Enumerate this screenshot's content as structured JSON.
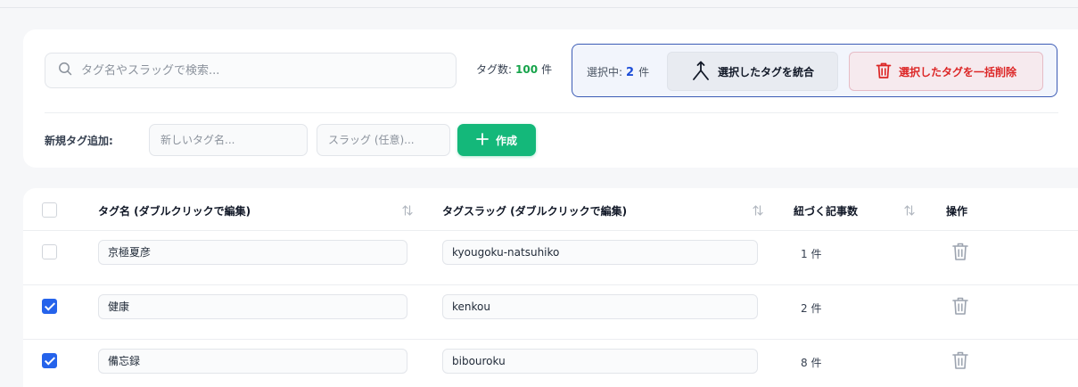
{
  "search": {
    "placeholder": "タグ名やスラッグで検索...",
    "value": ""
  },
  "tag_count": {
    "label": "タグ数:",
    "value": "100",
    "unit": "件"
  },
  "selection": {
    "label": "選択中:",
    "count": "2",
    "unit": "件",
    "merge_label": "選択したタグを統合",
    "delete_label": "選択したタグを一括削除"
  },
  "new_tag": {
    "label": "新規タグ追加:",
    "name_placeholder": "新しいタグ名...",
    "slug_placeholder": "スラッグ (任意)...",
    "create_label": "作成"
  },
  "table": {
    "headers": {
      "name": "タグ名 (ダブルクリックで編集)",
      "slug": "タグスラッグ (ダブルクリックで編集)",
      "count": "紐づく記事数",
      "actions": "操作"
    },
    "rows": [
      {
        "checked": false,
        "name": "京極夏彦",
        "slug": "kyougoku-natsuhiko",
        "count": "1 件"
      },
      {
        "checked": true,
        "name": "健康",
        "slug": "kenkou",
        "count": "2 件"
      },
      {
        "checked": true,
        "name": "備忘録",
        "slug": "bibouroku",
        "count": "8 件"
      }
    ]
  },
  "colors": {
    "accent_green": "#14b87a",
    "accent_blue": "#2563eb",
    "danger_red": "#dc2626"
  },
  "icons": {
    "search": "search-icon",
    "merge": "merge-icon",
    "delete": "trash-icon",
    "create": "plus-icon",
    "sort": "sort-icon"
  }
}
